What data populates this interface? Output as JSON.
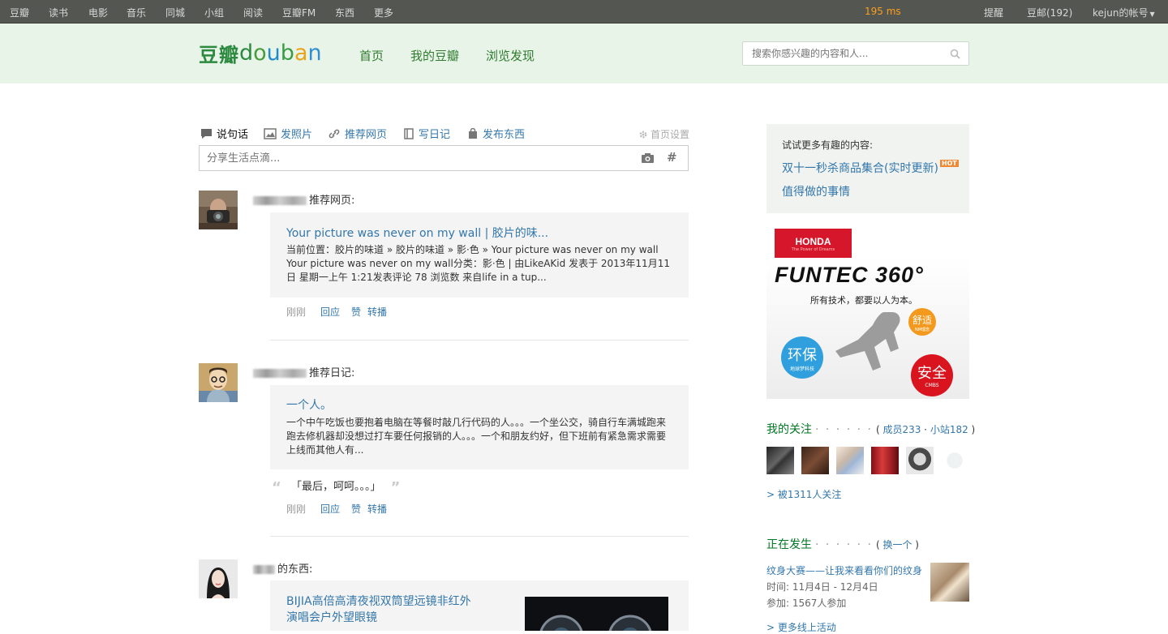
{
  "global_nav": {
    "items": [
      "豆瓣",
      "读书",
      "电影",
      "音乐",
      "同城",
      "小组",
      "阅读",
      "豆瓣FM",
      "东西",
      "更多"
    ],
    "latency": "195 ms",
    "remind": "提醒",
    "mail": "豆邮(192)",
    "account": "kejun的帐号"
  },
  "header": {
    "logo_cn": "豆瓣",
    "logo_en": [
      "d",
      "o",
      "u",
      "b",
      "a",
      "n"
    ],
    "nav": [
      "首页",
      "我的豆瓣",
      "浏览发现"
    ],
    "search_placeholder": "搜索你感兴趣的内容和人..."
  },
  "publish": {
    "tabs": [
      "说句话",
      "发照片",
      "推荐网页",
      "写日记",
      "发布东西"
    ],
    "settings": "首页设置",
    "share_placeholder": "分享生活点滴...",
    "hash": "#"
  },
  "feed": [
    {
      "action": "推荐网页:",
      "title": "Your picture was never on my wall | 胶片的味...",
      "desc": "当前位置：胶片的味道 » 胶片的味道 » 影·色 » Your picture was never on my wall Your picture was never on my wall分类：影·色 | 由LikeAKid 发表于 2013年11月11日 星期一上午 1:21发表评论 78 浏览数 来自life in a tup...",
      "time": "刚刚",
      "reply": "回应",
      "like": "赞",
      "reshare": "转播"
    },
    {
      "action": "推荐日记:",
      "title": "一个人。",
      "desc": "一个中午吃饭也要抱着电脑在等餐时敲几行代码的人。。。一个坐公交，骑自行车满城跑来跑去修机器却没想过打车要任何报销的人。。。一个和朋友约好，但下班前有紧急需求需要上线而其他人有...",
      "quote": "「最后，呵呵。。。」",
      "time": "刚刚",
      "reply": "回应",
      "like": "赞",
      "reshare": "转播"
    },
    {
      "action": "的东西:",
      "title_line1": "BIJIA高倍高清夜视双筒望远镜非红外",
      "title_line2": "演唱会户外望眼镜"
    }
  ],
  "sidebar": {
    "try_header": "试试更多有趣的内容:",
    "links": [
      "双十一秒杀商品集合(实时更新)",
      "值得做的事情"
    ],
    "hot": "HOT",
    "ad": {
      "brand": "HONDA",
      "brand_sub": "The Power of Dreams",
      "headline": "FUNTEC 360°",
      "slogan": "所有技术，都要以人为本。",
      "badge1": "舒适",
      "badge1_sub": "NM理念",
      "badge2": "环保",
      "badge2_sub": "地球梦科技",
      "badge3": "安全",
      "badge3_sub": "CMBS"
    },
    "following": {
      "title": "我的关注",
      "dots": "· · · · · ·",
      "members": "成员233",
      "sites": "小站182",
      "followed": "> 被1311人关注"
    },
    "happening": {
      "title": "正在发生",
      "dots": "· · · · · ·",
      "switch": "换一个",
      "event_title": "纹身大赛——让我来看看你们的纹身",
      "time_label": "时间:",
      "time_value": "11月4日 - 12月4日",
      "join_label": "参加:",
      "join_value": "1567人参加",
      "more": "> 更多线上活动"
    }
  },
  "colors": {
    "topbar": "#545652",
    "header_bg": "#e9f4e9",
    "link": "#3377aa",
    "green": "#007722",
    "latency": "#ff9f1a"
  }
}
